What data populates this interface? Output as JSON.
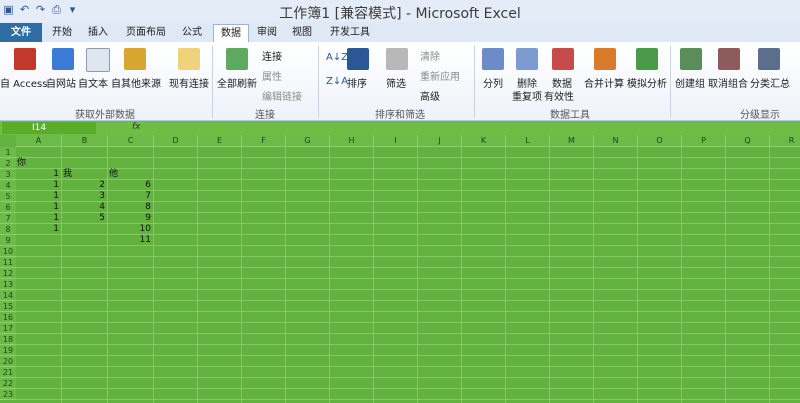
{
  "window": {
    "title": "工作簿1 [兼容模式] - Microsoft Excel"
  },
  "qat": [
    "save-icon",
    "undo-icon",
    "redo-icon",
    "print-preview-icon",
    "customize-icon"
  ],
  "tabs": [
    {
      "label": "文件"
    },
    {
      "label": "开始"
    },
    {
      "label": "插入"
    },
    {
      "label": "页面布局"
    },
    {
      "label": "公式"
    },
    {
      "label": "数据"
    },
    {
      "label": "审阅"
    },
    {
      "label": "视图"
    },
    {
      "label": "开发工具"
    }
  ],
  "ribbon": {
    "get_external": {
      "label": "获取外部数据",
      "buttons": [
        "自 Access",
        "自网站",
        "自文本",
        "自其他来源",
        "现有连接"
      ]
    },
    "connections": {
      "label": "连接",
      "refresh": "全部刷新",
      "items": [
        "连接",
        "属性",
        "编辑链接"
      ]
    },
    "sort_filter": {
      "label": "排序和筛选",
      "sort": "排序",
      "filter": "筛选",
      "items": [
        "清除",
        "重新应用",
        "高级"
      ]
    },
    "data_tools": {
      "label": "数据工具",
      "buttons": [
        "分列",
        "删除",
        "重复项",
        "数据",
        "有效性",
        "合并计算",
        "模拟分析"
      ]
    },
    "outline": {
      "label": "分级显示",
      "buttons": [
        "创建组",
        "取消组合",
        "分类汇总"
      ]
    }
  },
  "formula_bar": {
    "name_box": "I14",
    "fx": "fx"
  },
  "columns": [
    "A",
    "B",
    "C",
    "D",
    "E",
    "F",
    "G",
    "H",
    "I",
    "J",
    "K",
    "L",
    "M",
    "N",
    "O",
    "P",
    "Q",
    "R"
  ],
  "rows": [
    "1",
    "2",
    "3",
    "4",
    "5",
    "6",
    "7",
    "8",
    "9",
    "10",
    "11",
    "12",
    "13",
    "14",
    "15",
    "16",
    "17",
    "18",
    "19",
    "20",
    "21",
    "22",
    "23"
  ],
  "cells": {
    "A2": "你",
    "A3": "1",
    "B3": "我",
    "C3": "他",
    "A4": "1",
    "B4": "2",
    "C4": "6",
    "A5": "1",
    "B5": "3",
    "C5": "7",
    "A6": "1",
    "B6": "4",
    "C6": "8",
    "A7": "1",
    "B7": "5",
    "C7": "9",
    "A8": "1",
    "C8": "10",
    "C9": "11"
  }
}
